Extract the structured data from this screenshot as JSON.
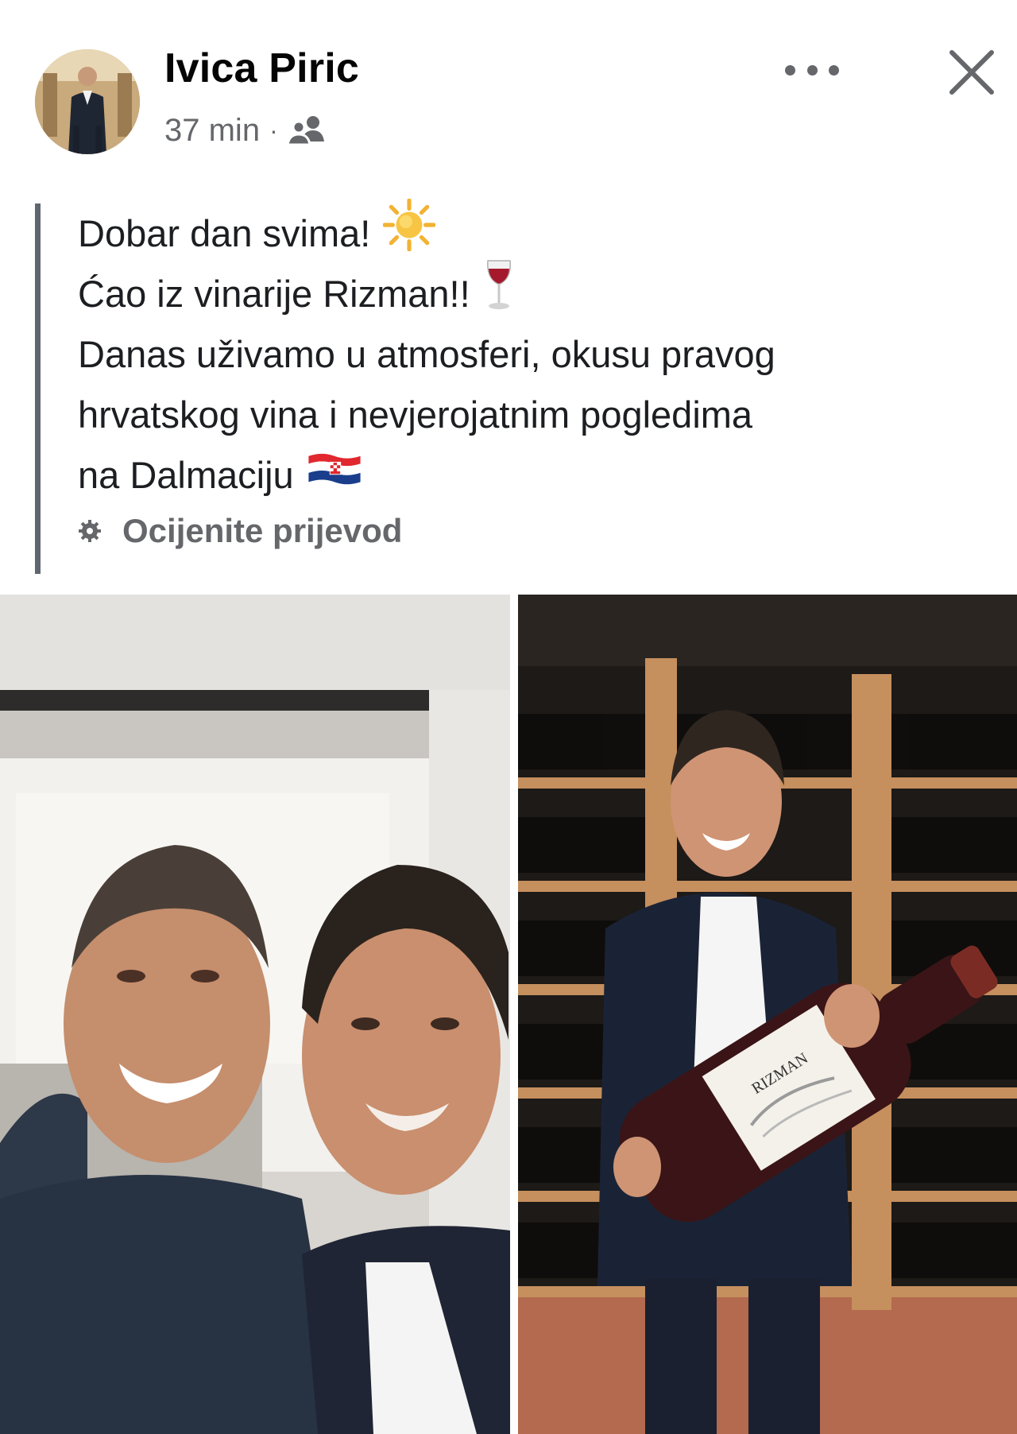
{
  "post": {
    "author_name": "Ivica Piric",
    "timestamp": "37 min",
    "separator": "·",
    "audience_icon": "friends-icon",
    "more_icon": "more-options-icon",
    "close_icon": "close-icon",
    "text_lines": [
      "Dobar dan svima!",
      "Ćao iz vinarije Rizman!!",
      "Danas uživamo u atmosferi, okusu pravog",
      "hrvatskog vina i nevjerojatnim pogledima",
      "na Dalmaciju"
    ],
    "emojis": {
      "line1": "sun-emoji",
      "line2": "wine-glass-emoji",
      "line5": "croatia-flag-emoji"
    },
    "translation_label": "Ocijenite prijevod",
    "translation_icon": "gear-icon"
  },
  "photos": [
    {
      "name": "selfie-photo",
      "description_icon": "photo"
    },
    {
      "name": "wine-cellar-photo",
      "bottle_label": "RIZMAN"
    }
  ]
}
